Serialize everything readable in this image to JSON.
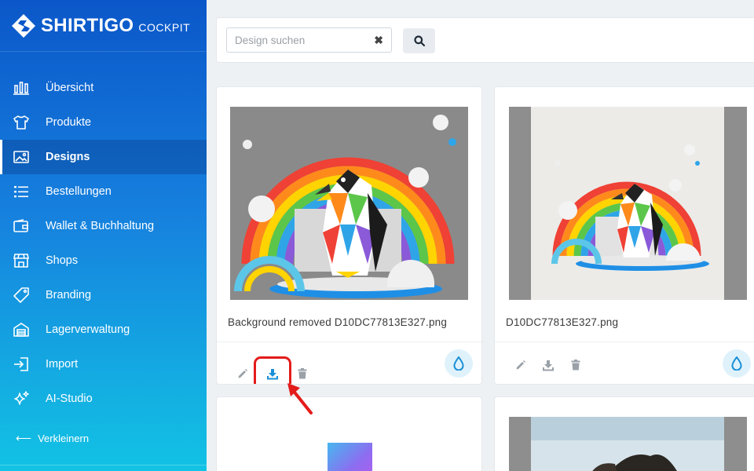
{
  "brand": {
    "name": "SHIRTIGO",
    "sub": "COCKPIT"
  },
  "sidebar": {
    "items": [
      {
        "label": "Übersicht",
        "icon": "chart-icon"
      },
      {
        "label": "Produkte",
        "icon": "shirt-icon"
      },
      {
        "label": "Designs",
        "icon": "image-icon",
        "active": true
      },
      {
        "label": "Bestellungen",
        "icon": "list-icon"
      },
      {
        "label": "Wallet & Buchhaltung",
        "icon": "wallet-icon"
      },
      {
        "label": "Shops",
        "icon": "store-icon"
      },
      {
        "label": "Branding",
        "icon": "tag-icon"
      },
      {
        "label": "Lagerverwaltung",
        "icon": "warehouse-icon"
      },
      {
        "label": "Import",
        "icon": "import-icon"
      },
      {
        "label": "AI-Studio",
        "icon": "sparkles-icon"
      }
    ],
    "collapse_label": "Verkleinern"
  },
  "search": {
    "placeholder": "Design suchen",
    "value": ""
  },
  "cards": [
    {
      "filename": "Background removed D10DC77813E327.png"
    },
    {
      "filename": "D10DC77813E327.png"
    }
  ],
  "colors": {
    "accent": "#1a8fd6",
    "highlight": "#e41b1b"
  }
}
